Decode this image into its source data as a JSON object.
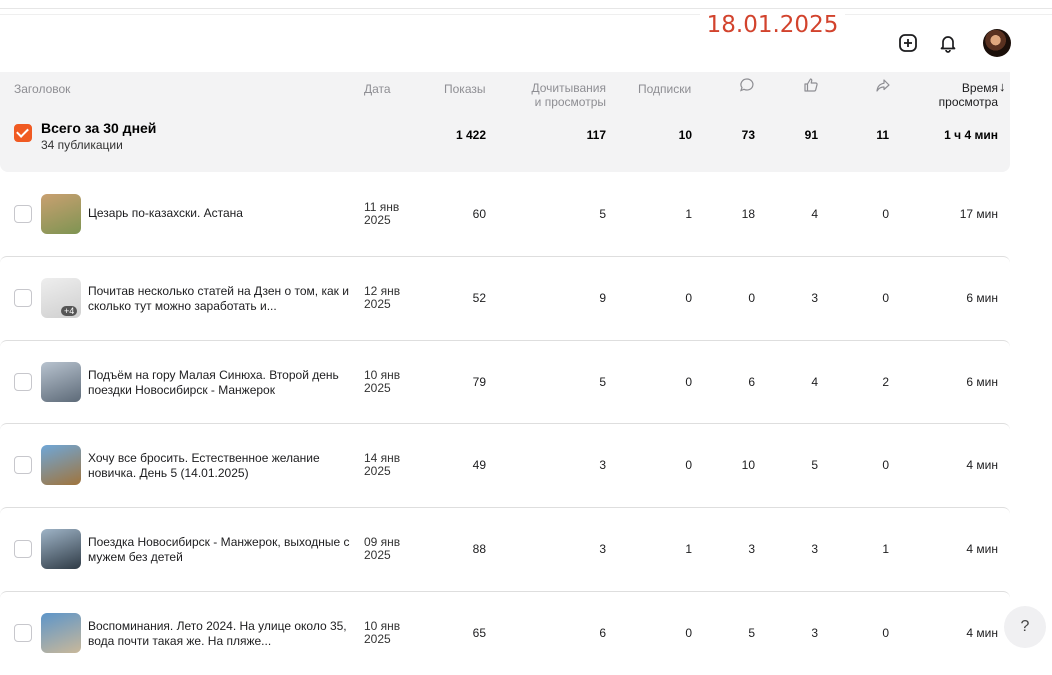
{
  "overlay_date": "18.01.2025",
  "header": {
    "add_icon": "plus-square-icon",
    "bell_icon": "bell-icon"
  },
  "columns": {
    "title": "Заголовок",
    "date": "Дата",
    "shows": "Показы",
    "reads": "Дочитывания\nи просмотры",
    "subs": "Подписки",
    "comments_icon": "comment-icon",
    "likes_icon": "thumbs-up-icon",
    "shares_icon": "share-icon",
    "time": "Время\nпросмотра",
    "sort_arrow": "↓"
  },
  "summary": {
    "title": "Всего за 30 дней",
    "subtitle": "34 публикации",
    "shows": "1 422",
    "reads": "117",
    "subs": "10",
    "comments": "73",
    "likes": "91",
    "shares": "11",
    "time": "1 ч 4 мин"
  },
  "rows": [
    {
      "title": "Цезарь по-казахски. Астана",
      "date1": "11 янв",
      "date2": "2025",
      "shows": "60",
      "reads": "5",
      "subs": "1",
      "comments": "18",
      "likes": "4",
      "shares": "0",
      "time": "17 мин",
      "thumb_colors": [
        "#c9a071",
        "#7e9452"
      ]
    },
    {
      "title": "Почитав несколько статей на Дзен о том, как и сколько тут можно заработать и...",
      "date1": "12 янв",
      "date2": "2025",
      "shows": "52",
      "reads": "9",
      "subs": "0",
      "comments": "0",
      "likes": "3",
      "shares": "0",
      "time": "6 мин",
      "thumb_badge": "+4",
      "thumb_colors": [
        "#eeeeee",
        "#cfcfcf"
      ]
    },
    {
      "title": "Подъём на гору Малая Синюха. Второй день поездки Новосибирск - Манжерок",
      "date1": "10 янв",
      "date2": "2025",
      "shows": "79",
      "reads": "5",
      "subs": "0",
      "comments": "6",
      "likes": "4",
      "shares": "2",
      "time": "6 мин",
      "thumb_colors": [
        "#b8c3cf",
        "#5d6a78"
      ]
    },
    {
      "title": "Хочу все бросить. Естественное желание новичка. День 5 (14.01.2025)",
      "date1": "14 янв",
      "date2": "2025",
      "shows": "49",
      "reads": "3",
      "subs": "0",
      "comments": "10",
      "likes": "5",
      "shares": "0",
      "time": "4 мин",
      "thumb_colors": [
        "#6fa7d8",
        "#a0743c"
      ]
    },
    {
      "title": "Поездка Новосибирск - Манжерок, выходные с мужем без детей",
      "date1": "09 янв",
      "date2": "2025",
      "shows": "88",
      "reads": "3",
      "subs": "1",
      "comments": "3",
      "likes": "3",
      "shares": "1",
      "time": "4 мин",
      "thumb_colors": [
        "#9fb4c7",
        "#2f3b46"
      ]
    },
    {
      "title": "Воспоминания. Лето 2024. На улице около 35, вода почти такая же. На пляже...",
      "date1": "10 янв",
      "date2": "2025",
      "shows": "65",
      "reads": "6",
      "subs": "0",
      "comments": "5",
      "likes": "3",
      "shares": "0",
      "time": "4 мин",
      "thumb_colors": [
        "#5d95c9",
        "#c9b89a"
      ]
    }
  ],
  "help_label": "?"
}
